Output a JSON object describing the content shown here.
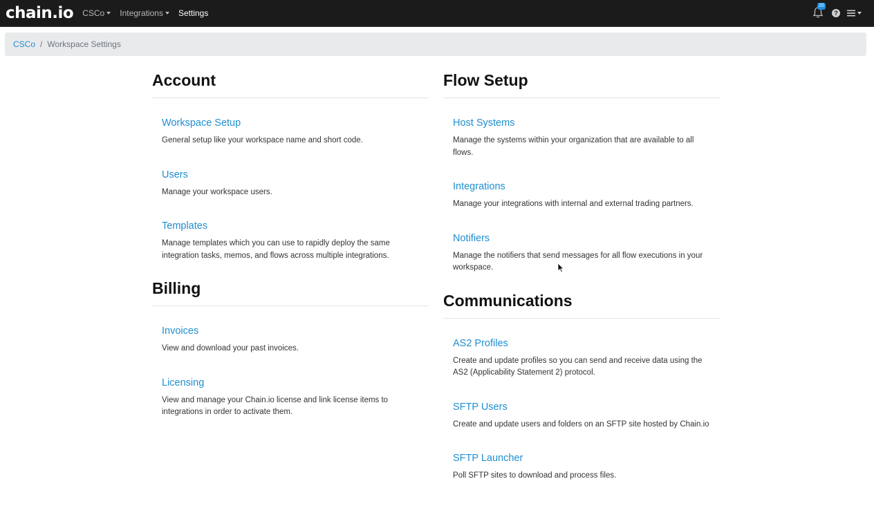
{
  "navbar": {
    "brand": "chain.io",
    "menus": [
      {
        "label": "CSCo",
        "has_caret": true
      },
      {
        "label": "Integrations",
        "has_caret": true
      },
      {
        "label": "Settings",
        "active": true
      }
    ],
    "notification_count": "20"
  },
  "breadcrumb": {
    "link": "CSCo",
    "separator": "/",
    "current": "Workspace Settings"
  },
  "sections": {
    "account": {
      "title": "Account",
      "items": [
        {
          "title": "Workspace Setup",
          "desc": "General setup like your workspace name and short code."
        },
        {
          "title": "Users",
          "desc": "Manage your workspace users."
        },
        {
          "title": "Templates",
          "desc": "Manage templates which you can use to rapidly deploy the same integration tasks, memos, and flows across multiple integrations."
        }
      ]
    },
    "billing": {
      "title": "Billing",
      "items": [
        {
          "title": "Invoices",
          "desc": "View and download your past invoices."
        },
        {
          "title": "Licensing",
          "desc": "View and manage your Chain.io license and link license items to integrations in order to activate them."
        }
      ]
    },
    "flow_setup": {
      "title": "Flow Setup",
      "items": [
        {
          "title": "Host Systems",
          "desc": "Manage the systems within your organization that are available to all flows."
        },
        {
          "title": "Integrations",
          "desc": "Manage your integrations with internal and external trading partners."
        },
        {
          "title": "Notifiers",
          "desc": "Manage the notifiers that send messages for all flow executions in your workspace."
        }
      ]
    },
    "communications": {
      "title": "Communications",
      "items": [
        {
          "title": "AS2 Profiles",
          "desc": "Create and update profiles so you can send and receive data using the AS2 (Applicability Statement 2) protocol."
        },
        {
          "title": "SFTP Users",
          "desc": "Create and update users and folders on an SFTP site hosted by Chain.io"
        },
        {
          "title": "SFTP Launcher",
          "desc": "Poll SFTP sites to download and process files."
        }
      ]
    }
  },
  "colors": {
    "navbar_bg": "#1b1b1b",
    "link": "#1e8ecf",
    "badge": "#1e8ee0",
    "breadcrumb_bg": "#e9eaec"
  },
  "icons": {
    "bell": "bell-icon",
    "help": "help-icon",
    "menu": "hamburger-menu-icon"
  }
}
